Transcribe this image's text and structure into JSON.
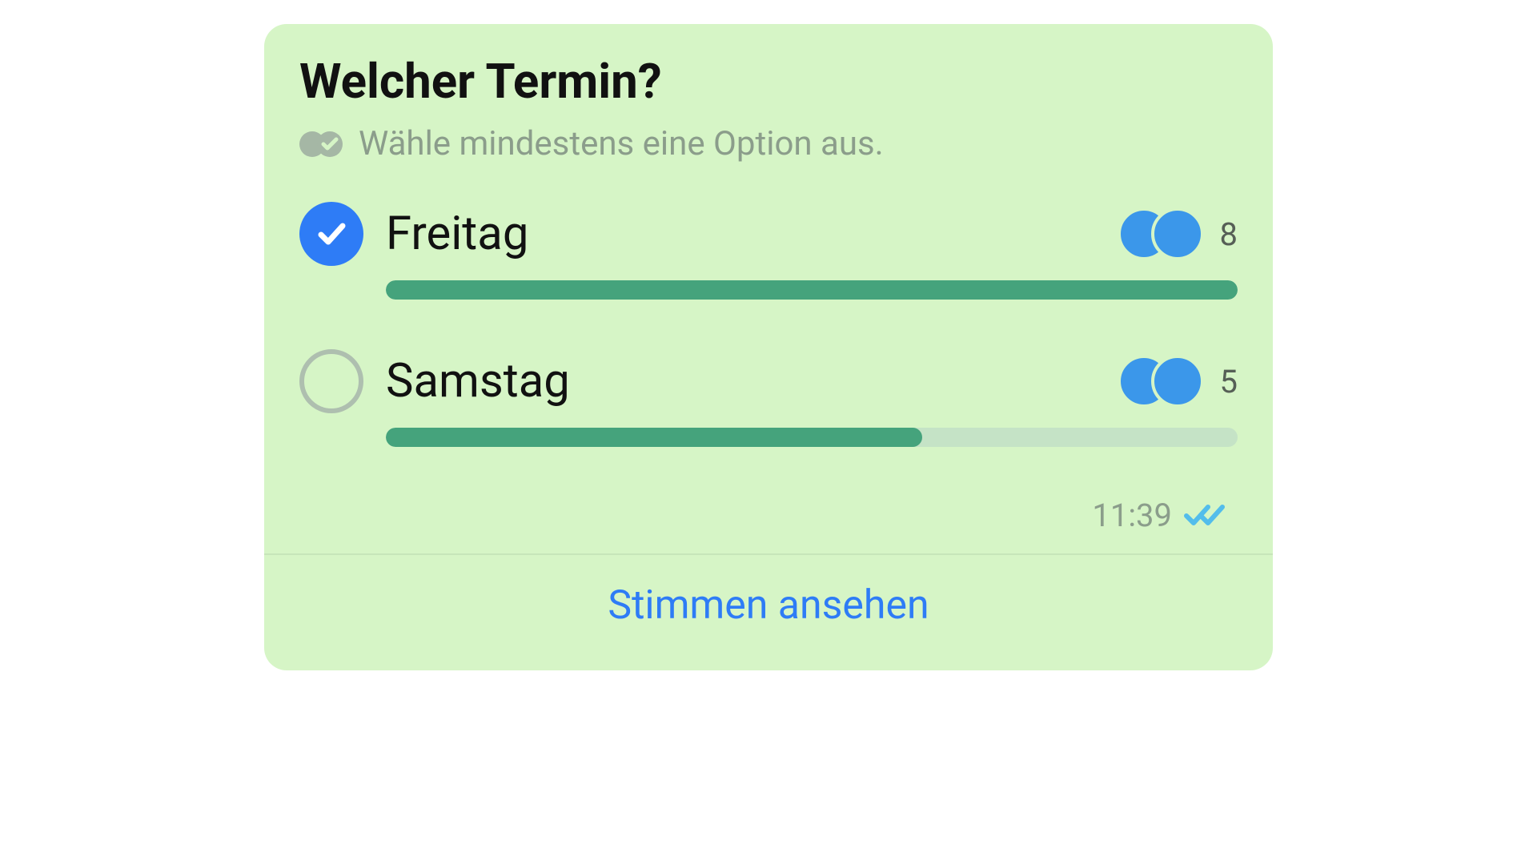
{
  "poll": {
    "question": "Welcher Termin?",
    "instruction": "Wähle mindestens eine Option aus.",
    "timestamp": "11:39",
    "viewVotesLabel": "Stimmen ansehen",
    "readState": "read",
    "colors": {
      "bubble": "#d6f5c6",
      "barFill": "#45a37c",
      "barTrack": "#c5e3c6",
      "link": "#2e7cf6",
      "checkSelected": "#2e7cf6",
      "avatar": "#3b97ea",
      "readTicks": "#53bdeb"
    },
    "options": [
      {
        "label": "Freitag",
        "votes": 8,
        "percent": 100,
        "selected": true,
        "voterAvatars": 2
      },
      {
        "label": "Samstag",
        "votes": 5,
        "percent": 63,
        "selected": false,
        "voterAvatars": 2
      }
    ]
  }
}
